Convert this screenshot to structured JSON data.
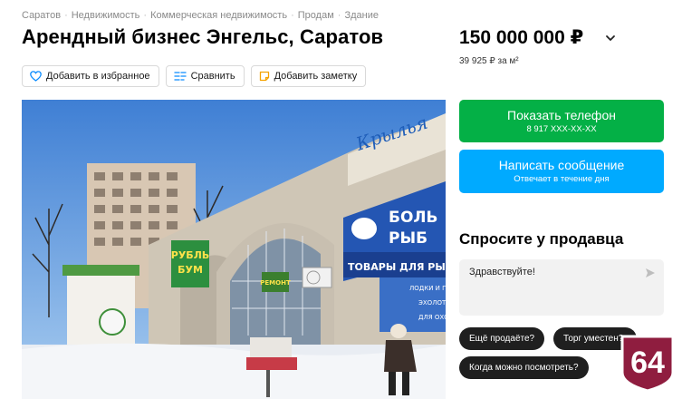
{
  "breadcrumbs": [
    "Саратов",
    "Недвижимость",
    "Коммерческая недвижимость",
    "Продам",
    "Здание"
  ],
  "title": "Арендный бизнес Энгельс, Саратов",
  "price": {
    "main": "150 000 000 ₽",
    "per_sqm": "39 925 ₽ за м²"
  },
  "actions": {
    "favorite": "Добавить в избранное",
    "compare": "Сравнить",
    "note": "Добавить заметку"
  },
  "contact": {
    "phone_title": "Показать телефон",
    "phone_masked": "8 917 XXX-XX-XX",
    "message_title": "Написать сообщение",
    "message_sub": "Отвечает в течение дня"
  },
  "ask": {
    "title": "Спросите у продавца",
    "message": "Здравствуйте!",
    "chips": [
      "Ещё продаёте?",
      "Торг уместен?",
      "Когда можно посмотреть?"
    ]
  },
  "photo": {
    "signs": {
      "roof": "Крылья",
      "ruble": "РУБЛЬ",
      "bum": "БУМ",
      "repair": "РЕМОНТ",
      "fish_top": "БОЛЬ",
      "fish_bottom": "РЫБ",
      "fish_goods": "ТОВАРЫ ДЛЯ РЫБА",
      "fish_extra": [
        "ЛОДКИ И ПР",
        "ЭХОЛОТЫ",
        "ДЛЯ ОХО"
      ]
    }
  },
  "badge": {
    "text": "64",
    "color": "#8f1d3f"
  },
  "colors": {
    "green": "#04b046",
    "blue": "#00aaff",
    "chip": "#1f1f1f"
  }
}
